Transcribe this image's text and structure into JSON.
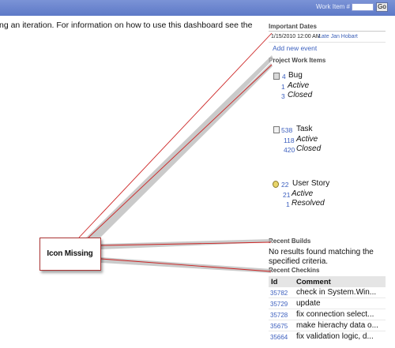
{
  "header": {
    "work_item_label": "Work Item #",
    "work_item_input_value": "",
    "go_label": "Go"
  },
  "intro_text": "ng an iteration. For information on how to use this dashboard see the",
  "important_dates": {
    "title": "Important Dates",
    "event_date": "1/15/2010 12:00 AM",
    "event_name": "Late Jan Hobart",
    "add_event": "Add new event"
  },
  "project_work_items": {
    "title": "Project Work Items",
    "groups": [
      {
        "icon": "bug-icon",
        "count": "4",
        "name": "Bug",
        "states": [
          {
            "count": "1",
            "label": "Active"
          },
          {
            "count": "3",
            "label": "Closed"
          }
        ]
      },
      {
        "icon": "task-icon",
        "count": "538",
        "name": "Task",
        "states": [
          {
            "count": "118",
            "label": "Active"
          },
          {
            "count": "420",
            "label": "Closed"
          }
        ]
      },
      {
        "icon": "user-story-icon",
        "count": "22",
        "name": "User Story",
        "states": [
          {
            "count": "21",
            "label": "Active"
          },
          {
            "count": "1",
            "label": "Resolved"
          }
        ]
      }
    ]
  },
  "recent_builds": {
    "title": "Recent Builds",
    "message_line1": "No results found matching the",
    "message_line2": "specified criteria."
  },
  "recent_checkins": {
    "title": "Recent Checkins",
    "columns": [
      "Id",
      "Comment"
    ],
    "rows": [
      {
        "id": "35782",
        "comment": "check in System.Win..."
      },
      {
        "id": "35729",
        "comment": "update"
      },
      {
        "id": "35728",
        "comment": "fix connection select..."
      },
      {
        "id": "35675",
        "comment": "make hierachy data o..."
      },
      {
        "id": "35664",
        "comment": "fix validation logic, d..."
      }
    ]
  },
  "callout": {
    "label": "Icon Missing"
  },
  "colors": {
    "header_bar": "#6b86cf",
    "link": "#3d60bf",
    "callout_border": "#aa3333"
  }
}
